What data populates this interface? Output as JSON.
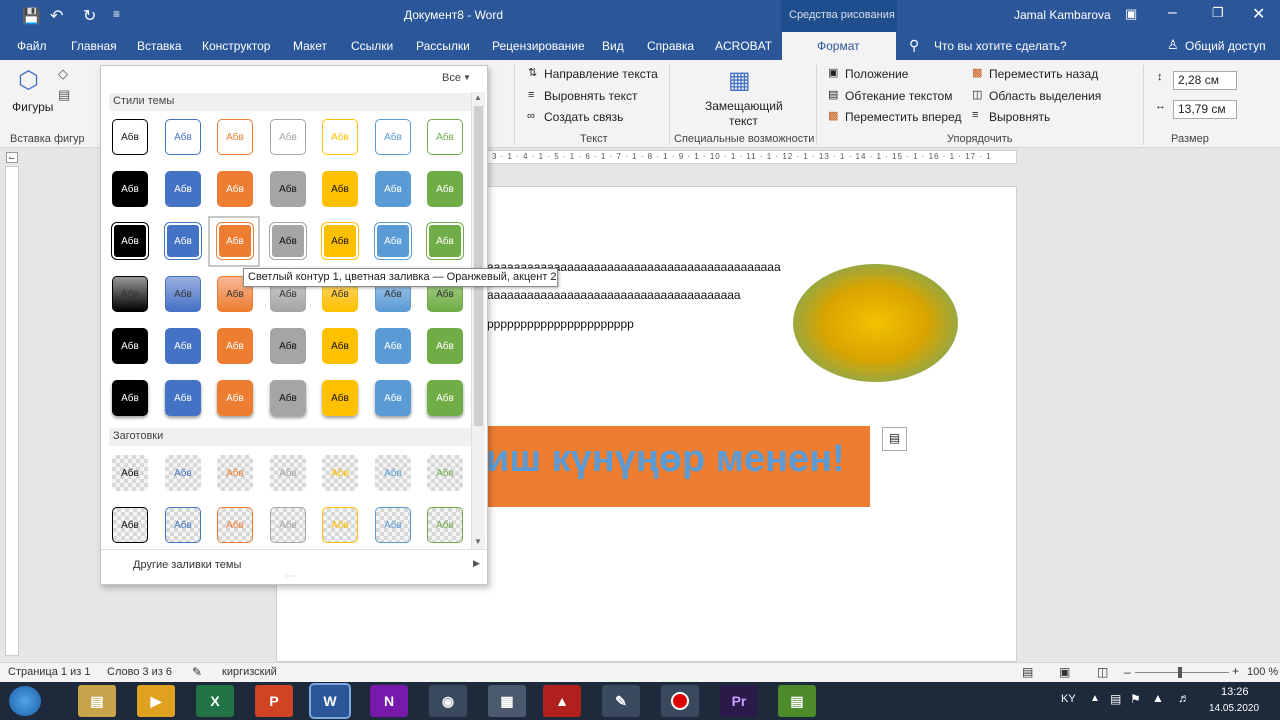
{
  "titlebar": {
    "title": "Документ8  -  Word",
    "tools_tab": "Средства рисования",
    "user": "Jamal Kambarova"
  },
  "tabs": [
    "Файл",
    "Главная",
    "Вставка",
    "Конструктор",
    "Макет",
    "Ссылки",
    "Рассылки",
    "Рецензирование",
    "Вид",
    "Справка",
    "ACROBAT",
    "Формат"
  ],
  "tellme": "Что вы хотите сделать?",
  "share": "Общий доступ",
  "ribbon": {
    "shapes": "Фигуры",
    "insert_shapes_group": "Вставка фигур",
    "text_direction": "Направление текста",
    "align_text": "Выровнять текст",
    "create_link": "Создать связь",
    "text_group": "Текст",
    "alt_text_line1": "Замещающий",
    "alt_text_line2": "текст",
    "accessibility_group": "Специальные возможности",
    "position": "Положение",
    "wrap_text": "Обтекание текстом",
    "bring_forward": "Переместить вперед",
    "send_backward": "Переместить назад",
    "selection_pane": "Область выделения",
    "align": "Выровнять",
    "arrange_group": "Упорядочить",
    "height": "2,28 см",
    "width": "13,79 см",
    "size_group": "Размер"
  },
  "ruler_marks": "3 · 1 · 4 · 1 · 5 · 1 · 6 · 1 · 7 · 1 · 8 · 1 · 9 · 1 · 10 · 1 · 11 · 1 · 12 · 1 · 13 · 1 · 14 · 1 · 15 · 1 · 16 · 1 · 17 · 1",
  "document": {
    "line1": "аааааааааааааааааааааааааааааааааааааааааааа",
    "line2": "аааааааааааааааааааааааааааааааааааааа",
    "line3": "рррррррррррррррррррррр",
    "banner": "иш күнүңөр менен!"
  },
  "gallery": {
    "filter": "Все",
    "theme_styles_header": "Стили темы",
    "presets_header": "Заготовки",
    "swatch_label": "Абв",
    "more_fills": "Другие заливки темы",
    "accent_colors": [
      "#000000",
      "#4472c4",
      "#ed7d31",
      "#a5a5a5",
      "#ffc000",
      "#5b9bd5",
      "#70ad47"
    ],
    "light_fills": [
      "#999999",
      "#9dafe0",
      "#f8b896",
      "#d0d0d0",
      "#ffd87a",
      "#a9cbeb",
      "#abd08f"
    ]
  },
  "tooltip": "Светлый контур 1, цветная заливка — Оранжевый, акцент 2",
  "status": {
    "page": "Страница 1 из 1",
    "words": "Слово 3 из 6",
    "language": "киргизский",
    "zoom": "100 %"
  },
  "taskbar": {
    "lang": "KY",
    "time": "13:26",
    "date": "14.05.2020"
  }
}
